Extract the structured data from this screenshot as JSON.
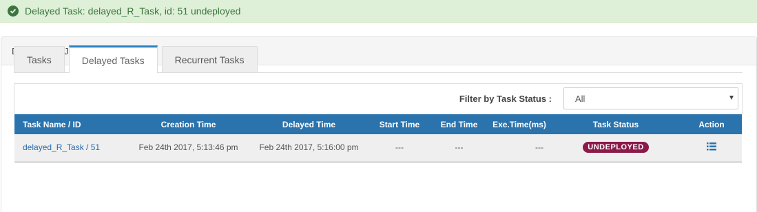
{
  "alert": {
    "message": "Delayed Task: delayed_R_Task, id: 51 undeployed",
    "icon": "check-circle-icon",
    "color": "#3c763d"
  },
  "panel": {
    "title": "DEMO_PROJECT/P1016"
  },
  "tabs": [
    {
      "label": "Tasks",
      "active": false
    },
    {
      "label": "Delayed Tasks",
      "active": true
    },
    {
      "label": "Recurrent Tasks",
      "active": false
    }
  ],
  "filter": {
    "label": "Filter by Task Status :",
    "selected": "All"
  },
  "table": {
    "columns": [
      "Task Name / ID",
      "Creation Time",
      "Delayed Time",
      "Start Time",
      "End Time",
      "Exe.Time(ms)",
      "Task Status",
      "Action"
    ],
    "rows": [
      {
        "task": "delayed_R_Task / 51",
        "creation_time": "Feb 24th 2017, 5:13:46 pm",
        "delayed_time": "Feb 24th 2017, 5:16:00 pm",
        "start_time": "---",
        "end_time": "---",
        "exe_time": "---",
        "status": "UNDEPLOYED",
        "action_icon": "list-icon"
      }
    ]
  },
  "colors": {
    "header_bg": "#2a73ad",
    "tab_accent": "#2a7fc0",
    "badge_bg": "#8b1a4a",
    "alert_bg": "#dff0d8"
  }
}
